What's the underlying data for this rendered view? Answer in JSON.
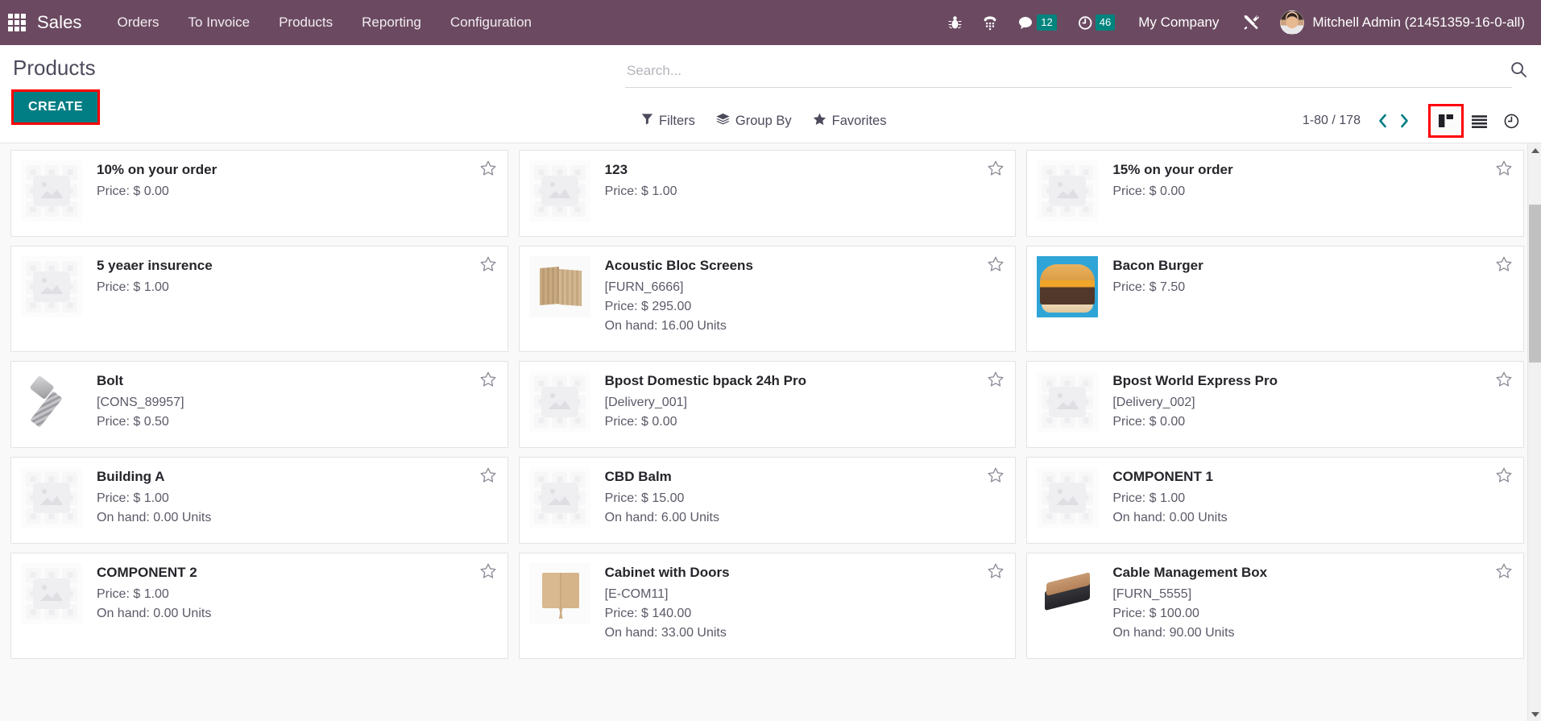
{
  "navbar": {
    "apps_icon": "apps-grid-icon",
    "brand": "Sales",
    "menu": [
      {
        "label": "Orders"
      },
      {
        "label": "To Invoice"
      },
      {
        "label": "Products"
      },
      {
        "label": "Reporting"
      },
      {
        "label": "Configuration"
      }
    ],
    "icons": [
      {
        "name": "bug-icon"
      },
      {
        "name": "dialpad-phone-icon"
      },
      {
        "name": "messages-icon",
        "badge": "12"
      },
      {
        "name": "activity-clock-icon",
        "badge": "46"
      }
    ],
    "company": "My Company",
    "settings_icon": "tools-wrench-icon",
    "user": "Mitchell Admin (21451359-16-0-all)",
    "avatar": "user-avatar",
    "background_color": "#6b4a61",
    "badge_color": "#00847d"
  },
  "control_panel": {
    "title": "Products",
    "create_label": "CREATE",
    "create_color": "#017e84",
    "highlight_color": "#ff0000",
    "search": {
      "placeholder": "Search...",
      "value": "",
      "icon": "search-icon"
    },
    "filters": [
      {
        "label": "Filters",
        "icon": "funnel-icon"
      },
      {
        "label": "Group By",
        "icon": "layers-icon"
      },
      {
        "label": "Favorites",
        "icon": "star-icon"
      }
    ],
    "pager": {
      "range": "1-80 / 178",
      "prev_icon": "chevron-left-icon",
      "next_icon": "chevron-right-icon",
      "arrow_color": "#017e84"
    },
    "views": [
      {
        "name": "kanban",
        "icon": "kanban-view-icon",
        "active": true
      },
      {
        "name": "list",
        "icon": "list-view-icon",
        "active": false
      },
      {
        "name": "activity",
        "icon": "activity-view-icon",
        "active": false
      }
    ]
  },
  "kanban": {
    "star_icon": "star-outline-icon",
    "cards": [
      {
        "name": "10% on your order",
        "ref": "",
        "price": "Price: $ 0.00",
        "onhand": "",
        "art": "placeholder"
      },
      {
        "name": "123",
        "ref": "",
        "price": "Price: $ 1.00",
        "onhand": "",
        "art": "placeholder"
      },
      {
        "name": "15% on your order",
        "ref": "",
        "price": "Price: $ 0.00",
        "onhand": "",
        "art": "placeholder"
      },
      {
        "name": "5 yeaer insurence",
        "ref": "",
        "price": "Price: $ 1.00",
        "onhand": "",
        "art": "placeholder"
      },
      {
        "name": "Acoustic Bloc Screens",
        "ref": "[FURN_6666]",
        "price": "Price: $ 295.00",
        "onhand": "On hand: 16.00 Units",
        "art": "screen"
      },
      {
        "name": "Bacon Burger",
        "ref": "",
        "price": "Price: $ 7.50",
        "onhand": "",
        "art": "burger"
      },
      {
        "name": "Bolt",
        "ref": "[CONS_89957]",
        "price": "Price: $ 0.50",
        "onhand": "",
        "art": "bolt"
      },
      {
        "name": "Bpost Domestic bpack 24h Pro",
        "ref": "[Delivery_001]",
        "price": "Price: $ 0.00",
        "onhand": "",
        "art": "placeholder"
      },
      {
        "name": "Bpost World Express Pro",
        "ref": "[Delivery_002]",
        "price": "Price: $ 0.00",
        "onhand": "",
        "art": "placeholder"
      },
      {
        "name": "Building A",
        "ref": "",
        "price": "Price: $ 1.00",
        "onhand": "On hand: 0.00 Units",
        "art": "placeholder"
      },
      {
        "name": "CBD Balm",
        "ref": "",
        "price": "Price: $ 15.00",
        "onhand": "On hand: 6.00 Units",
        "art": "placeholder"
      },
      {
        "name": "COMPONENT 1",
        "ref": "",
        "price": "Price: $ 1.00",
        "onhand": "On hand: 0.00 Units",
        "art": "placeholder"
      },
      {
        "name": "COMPONENT 2",
        "ref": "",
        "price": "Price: $ 1.00",
        "onhand": "On hand: 0.00 Units",
        "art": "placeholder"
      },
      {
        "name": "Cabinet with Doors",
        "ref": "[E-COM11]",
        "price": "Price: $ 140.00",
        "onhand": "On hand: 33.00 Units",
        "art": "cabinet"
      },
      {
        "name": "Cable Management Box",
        "ref": "[FURN_5555]",
        "price": "Price: $ 100.00",
        "onhand": "On hand: 90.00 Units",
        "art": "cablebox"
      }
    ]
  },
  "scrollbar": {
    "up_icon": "scroll-up-arrow-icon",
    "down_icon": "scroll-down-arrow-icon",
    "thumb": "scroll-thumb"
  }
}
